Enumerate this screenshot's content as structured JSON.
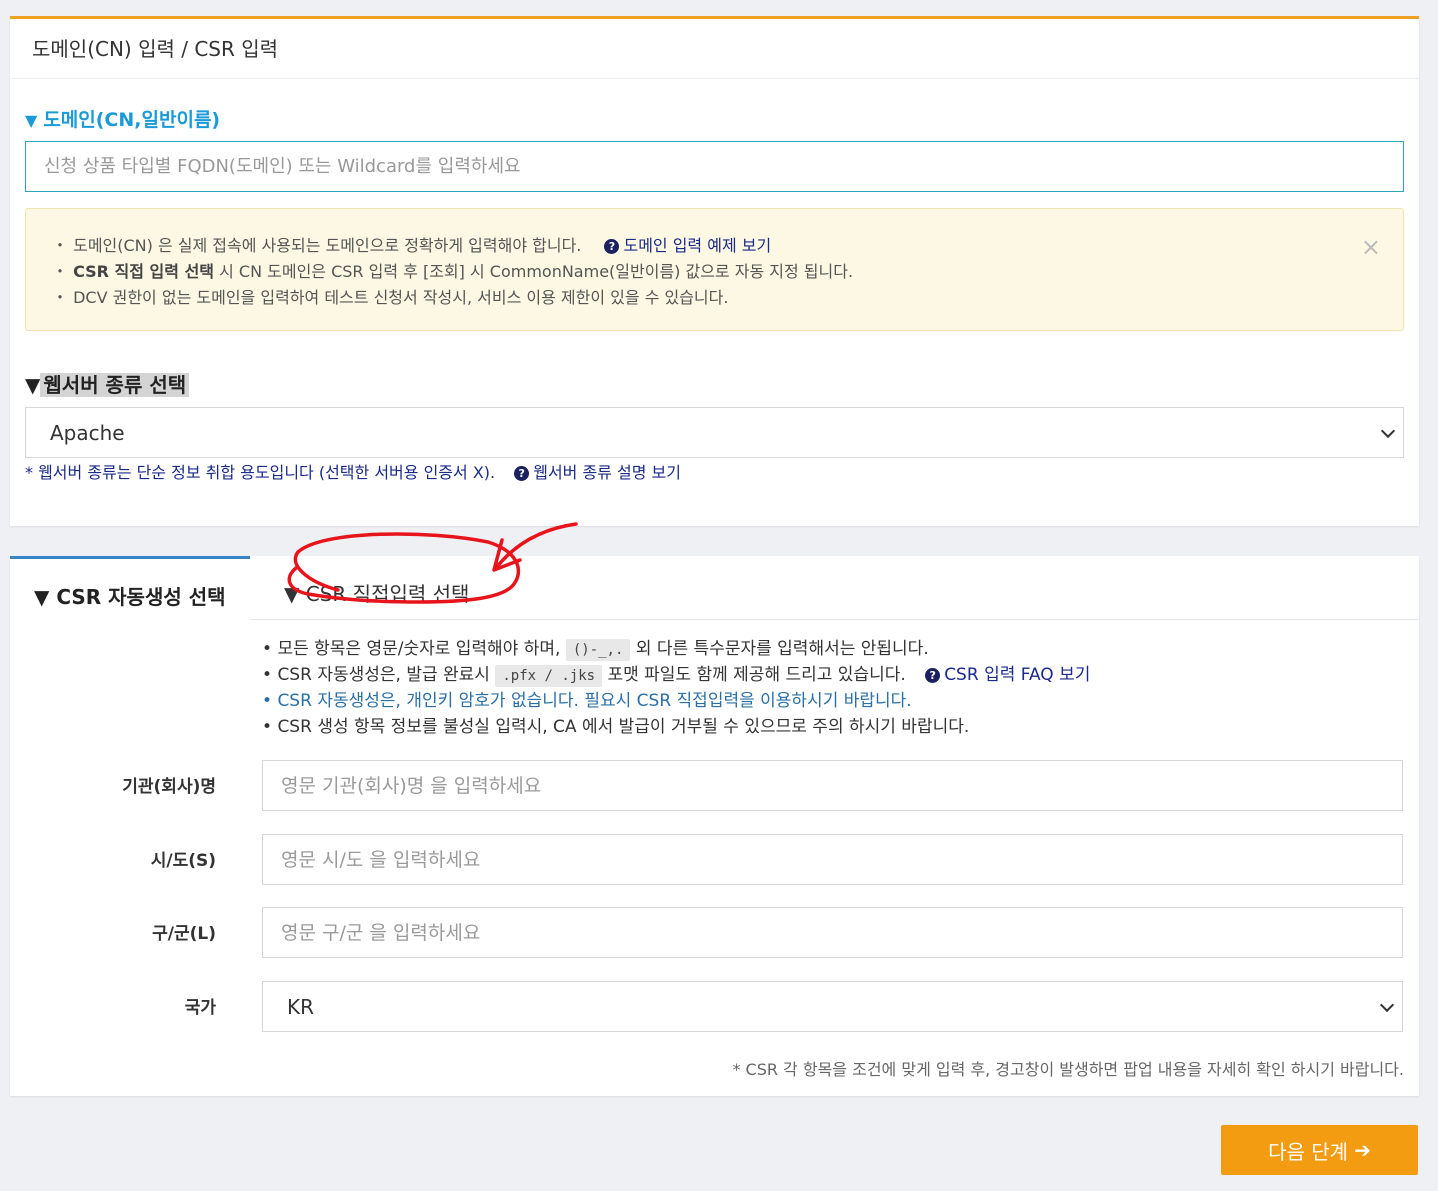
{
  "panel_title": "도메인(CN) 입력 / CSR 입력",
  "domain": {
    "label": "도메인(CN,일반이름)",
    "placeholder": "신청 상품 타입별 FQDN(도메인) 또는 Wildcard를 입력하세요"
  },
  "notice": {
    "line1": "도메인(CN) 은 실제 접속에 사용되는 도메인으로 정확하게 입력해야 합니다.",
    "line1_link": "도메인 입력 예제 보기",
    "line2_bold": "CSR 직접 입력 선택",
    "line2_rest": " 시 CN 도메인은 CSR 입력 후 [조회] 시 CommonName(일반이름) 값으로 자동 지정 됩니다.",
    "line3": "DCV 권한이 없는 도메인을 입력하여 테스트 신청서 작성시, 서비스 이용 제한이 있을 수 있습니다.",
    "close": "×"
  },
  "webserver": {
    "label": "웹서버 종류 선택",
    "selected": "Apache",
    "note": "* 웹서버 종류는 단순 정보 취합 용도입니다 (선택한 서버용 인증서 X).",
    "note_link": "웹서버 종류 설명 보기"
  },
  "csr_tabs": {
    "auto": "CSR 자동생성 선택",
    "manual": "CSR 직접입력 선택"
  },
  "csr_rules": {
    "r1_pre": "모든 항목은 영문/숫자로 입력해야 하며,",
    "r1_code": "()-_,.",
    "r1_post": "외 다른 특수문자를 입력해서는 안됩니다.",
    "r2_pre": "CSR 자동생성은, 발급 완료시",
    "r2_code": ".pfx / .jks",
    "r2_post": "포맷 파일도 함께 제공해 드리고 있습니다.",
    "r2_link": "CSR 입력 FAQ 보기",
    "r3": "CSR 자동생성은, 개인키 암호가 없습니다. 필요시 CSR 직접입력을 이용하시기 바랍니다.",
    "r4": "CSR 생성 항목 정보를 불성실 입력시, CA 에서 발급이 거부될 수 있으므로 주의 하시기 바랍니다."
  },
  "fields": {
    "org_label": "기관(회사)명",
    "org_placeholder": "영문 기관(회사)명 을 입력하세요",
    "state_label": "시/도(S)",
    "state_placeholder": "영문 시/도 을 입력하세요",
    "city_label": "구/군(L)",
    "city_placeholder": "영문 구/군 을 입력하세요",
    "country_label": "국가",
    "country_selected": "KR"
  },
  "csr_footnote": "* CSR 각 항목을 조건에 맞게 입력 후, 경고창이 발생하면 팝업 내용을 자세히 확인 하시기 바랍니다.",
  "next_button": "다음 단계",
  "colors": {
    "accent_orange": "#f39c12",
    "section_blue": "#1a9bd7",
    "link_navy": "#1a2a8c",
    "annotation_red": "#e8141c"
  },
  "icons": [
    "question-circle-icon",
    "close-icon",
    "chevron-down-icon",
    "arrow-right-icon"
  ]
}
